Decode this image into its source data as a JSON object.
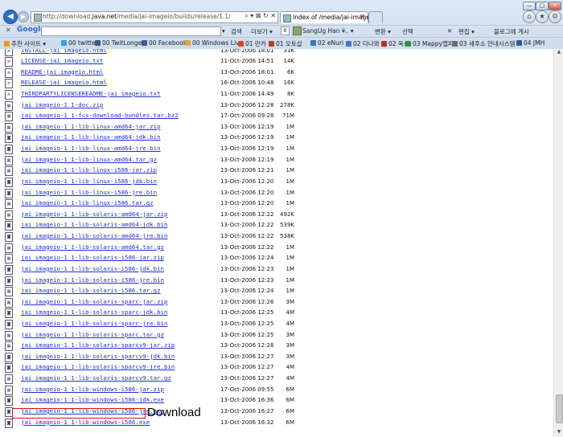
{
  "browser": {
    "address": {
      "url_prefix": "http://download.",
      "url_domain": "java.net",
      "url_suffix": "/media/jai-imageio/builds/release/1.1/",
      "tools": "⌕ ▾ ⊠ ↻ ✕"
    },
    "tabs": [
      {
        "title": "Index of /media/jai-image...",
        "close": "✕"
      }
    ],
    "window_buttons": {
      "min": "—",
      "max": "□",
      "close": "✕"
    }
  },
  "google_bar": {
    "close": "✕",
    "logo": "Google",
    "search_label": "검색",
    "more_label": "더보기 ▾",
    "badge": "0",
    "user": "SangUg Han ▾",
    "wrench": "🔧 ▾",
    "change_label": "변환 ▾",
    "select_label": "선택",
    "close2": "✕",
    "edit_label": "편집 ▾",
    "blog_label": "블로그에 게시"
  },
  "favorites": [
    {
      "label": "추천 사이트 ▾",
      "color": "#e89a1c"
    },
    {
      "label": "00 twitter",
      "color": "#2aa3e0"
    },
    {
      "label": "00 TwitLonger",
      "color": "#3b5a8a"
    },
    {
      "label": "00 Facebook",
      "color": "#3b5998"
    },
    {
      "label": "00 Windows Live",
      "color": "#e8a33b"
    },
    {
      "label": "01 만카",
      "color": "#d9442e"
    },
    {
      "label": "01 오토샵",
      "color": "#c0392b"
    },
    {
      "label": "02 eNuri",
      "color": "#2e7bc7"
    },
    {
      "label": "02 다나와",
      "color": "#3f7fbf"
    },
    {
      "label": "02 옥션",
      "color": "#c42828"
    },
    {
      "label": "03 Mappy맵피",
      "color": "#2f8f3a"
    },
    {
      "label": "03 새주소 안내시스템",
      "color": "#6a6a6a"
    },
    {
      "label": "04 JMH",
      "color": "#2d5aa0"
    }
  ],
  "files": [
    {
      "name": "INSTALL-jai_imageio.html",
      "date": "13-Oct-2006 18:01",
      "size": "31K"
    },
    {
      "name": "LICENSE-jai_imageio.txt",
      "date": "11-Oct-2006 14:51",
      "size": "14K"
    },
    {
      "name": "README-jai_imageio.html",
      "date": "13-Oct-2006 18:01",
      "size": "6K"
    },
    {
      "name": "RELEASE-jai_imageio.html",
      "date": "16-Oct-2006 10:48",
      "size": "16K"
    },
    {
      "name": "THIRDPARTYLICENSEREADME-jai_imageio.txt",
      "date": "11-Oct-2006 14:49",
      "size": "8K"
    },
    {
      "name": "jai_imageio-1_1-doc.zip",
      "date": "13-Oct-2006 12:28",
      "size": "278K"
    },
    {
      "name": "jai_imageio-1_1-fcs-download-bundles.tar.bz2",
      "date": "17-Oct-2006 09:28",
      "size": "71M"
    },
    {
      "name": "jai_imageio-1_1-lib-linux-amd64-jar.zip",
      "date": "13-Oct-2006 12:19",
      "size": "1M"
    },
    {
      "name": "jai_imageio-1_1-lib-linux-amd64-jdk.bin",
      "date": "13-Oct-2006 12:19",
      "size": "1M"
    },
    {
      "name": "jai_imageio-1_1-lib-linux-amd64-jre.bin",
      "date": "13-Oct-2006 12:19",
      "size": "1M"
    },
    {
      "name": "jai_imageio-1_1-lib-linux-amd64.tar.gz",
      "date": "13-Oct-2006 12:19",
      "size": "1M"
    },
    {
      "name": "jai_imageio-1_1-lib-linux-i586-jar.zip",
      "date": "13-Oct-2006 12:21",
      "size": "1M"
    },
    {
      "name": "jai_imageio-1_1-lib-linux-i586-jdk.bin",
      "date": "13-Oct-2006 12:20",
      "size": "1M"
    },
    {
      "name": "jai_imageio-1_1-lib-linux-i586-jre.bin",
      "date": "13-Oct-2006 12:20",
      "size": "1M"
    },
    {
      "name": "jai_imageio-1_1-lib-linux-i586.tar.gz",
      "date": "13-Oct-2006 12:20",
      "size": "1M"
    },
    {
      "name": "jai_imageio-1_1-lib-solaris-amd64-jar.zip",
      "date": "13-Oct-2006 12:22",
      "size": "492K"
    },
    {
      "name": "jai_imageio-1_1-lib-solaris-amd64-jdk.bin",
      "date": "13-Oct-2006 12:22",
      "size": "539K"
    },
    {
      "name": "jai_imageio-1_1-lib-solaris-amd64-jre.bin",
      "date": "13-Oct-2006 12:22",
      "size": "538K"
    },
    {
      "name": "jai_imageio-1_1-lib-solaris-amd64.tar.gz",
      "date": "13-Oct-2006 12:22",
      "size": "1M"
    },
    {
      "name": "jai_imageio-1_1-lib-solaris-i586-jar.zip",
      "date": "13-Oct-2006 12:24",
      "size": "1M"
    },
    {
      "name": "jai_imageio-1_1-lib-solaris-i586-jdk.bin",
      "date": "13-Oct-2006 12:23",
      "size": "1M"
    },
    {
      "name": "jai_imageio-1_1-lib-solaris-i586-jre.bin",
      "date": "13-Oct-2006 12:23",
      "size": "1M"
    },
    {
      "name": "jai_imageio-1_1-lib-solaris-i586.tar.gz",
      "date": "13-Oct-2006 12:24",
      "size": "1M"
    },
    {
      "name": "jai_imageio-1_1-lib-solaris-sparc-jar.zip",
      "date": "13-Oct-2006 12:26",
      "size": "3M"
    },
    {
      "name": "jai_imageio-1_1-lib-solaris-sparc-jdk.bin",
      "date": "13-Oct-2006 12:25",
      "size": "4M"
    },
    {
      "name": "jai_imageio-1_1-lib-solaris-sparc-jre.bin",
      "date": "13-Oct-2006 12:25",
      "size": "4M"
    },
    {
      "name": "jai_imageio-1_1-lib-solaris-sparc.tar.gz",
      "date": "13-Oct-2006 12:25",
      "size": "3M"
    },
    {
      "name": "jai_imageio-1_1-lib-solaris-sparcv9-jar.zip",
      "date": "13-Oct-2006 12:28",
      "size": "3M"
    },
    {
      "name": "jai_imageio-1_1-lib-solaris-sparcv9-jdk.bin",
      "date": "13-Oct-2006 12:27",
      "size": "3M"
    },
    {
      "name": "jai_imageio-1_1-lib-solaris-sparcv9-jre.bin",
      "date": "13-Oct-2006 12:27",
      "size": "4M"
    },
    {
      "name": "jai_imageio-1_1-lib-solaris-sparcv9.tar.gz",
      "date": "13-Oct-2006 12:27",
      "size": "4M"
    },
    {
      "name": "jai_imageio-1_1-lib-windows-i586-jar.zip",
      "date": "17-Oct-2006 09:55",
      "size": "6M"
    },
    {
      "name": "jai_imageio-1_1-lib-windows-i586-jdk.exe",
      "date": "13-Oct-2006 16:36",
      "size": "6M"
    },
    {
      "name": "jai_imageio-1_1-lib-windows-i586-jre.exe",
      "date": "13-Oct-2006 16:27",
      "size": "6M"
    },
    {
      "name": "jai_imageio-1_1-lib-windows-i586.exe",
      "date": "13-Oct-2006 16:32",
      "size": "6M"
    }
  ],
  "annotation": "Download"
}
